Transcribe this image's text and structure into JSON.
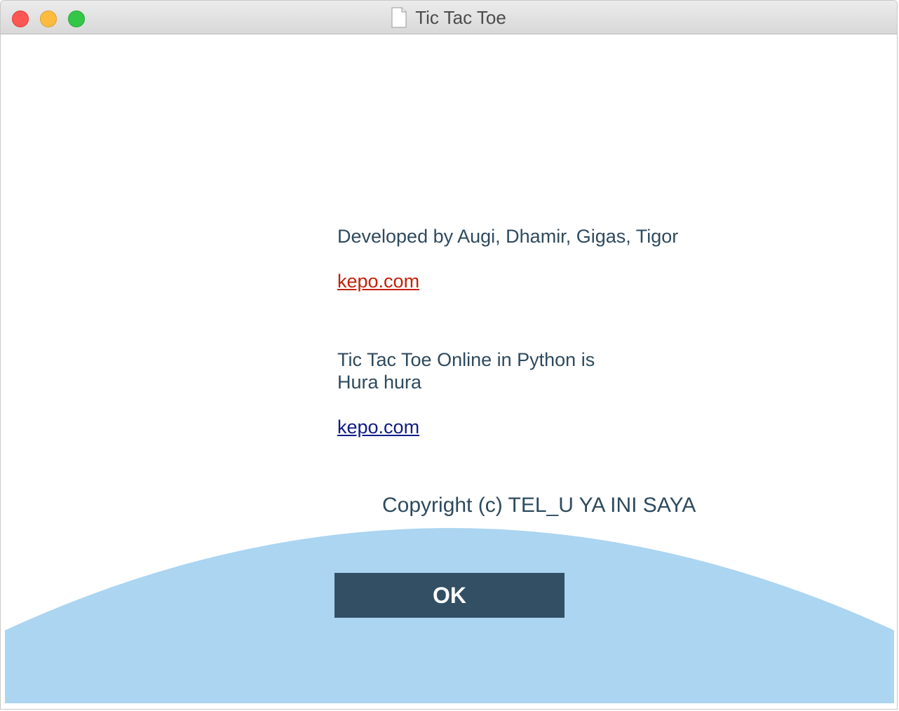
{
  "window": {
    "title": "Tic Tac Toe",
    "controls": {
      "close": "close-icon",
      "minimize": "minimize-icon",
      "zoom": "zoom-icon"
    }
  },
  "about": {
    "developers": "Developed by Augi, Dhamir, Gigas, Tigor",
    "link1": "kepo.com",
    "description_line1": "Tic Tac Toe Online in Python is",
    "description_line2": "Hura hura",
    "link2": "kepo.com",
    "copyright": "Copyright (c) TEL_U YA INI SAYA"
  },
  "actions": {
    "ok_label": "OK"
  },
  "colors": {
    "text": "#2e4a5e",
    "link_red": "#c1220a",
    "link_blue": "#0f1c86",
    "arc": "#abd5f1",
    "button_bg": "#324f64",
    "button_text": "#ffffff"
  }
}
